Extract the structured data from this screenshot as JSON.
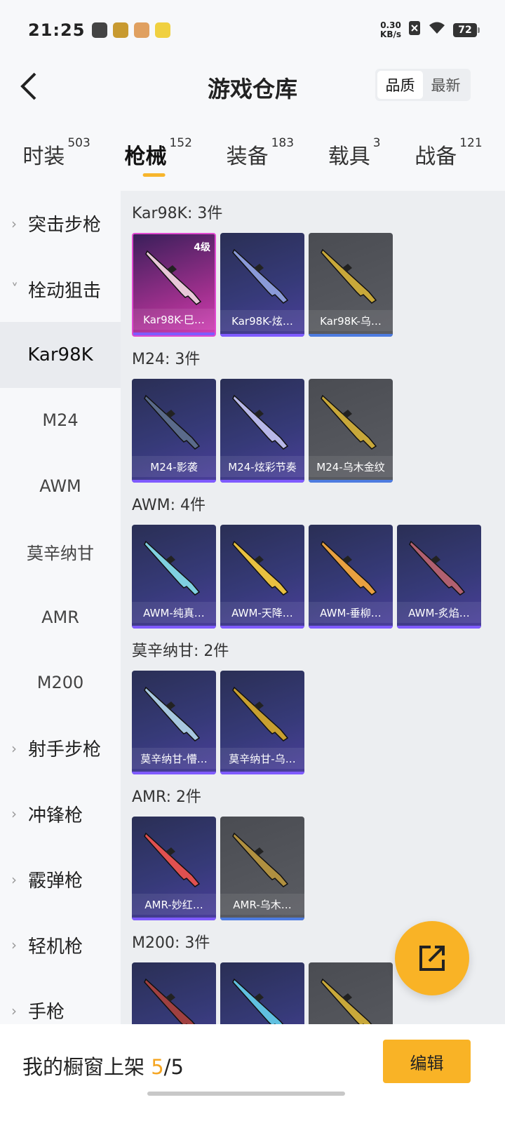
{
  "status_bar": {
    "time": "21:25",
    "speed_value": "0.30",
    "speed_unit": "KB/s",
    "battery": "72"
  },
  "header": {
    "title": "游戏仓库",
    "sort_options": [
      "品质",
      "最新"
    ],
    "active_sort": "品质"
  },
  "tabs": [
    {
      "label": "时装",
      "count": "503"
    },
    {
      "label": "枪械",
      "count": "152"
    },
    {
      "label": "装备",
      "count": "183"
    },
    {
      "label": "载具",
      "count": "3"
    },
    {
      "label": "战备",
      "count": "121"
    }
  ],
  "sidebar": {
    "items": [
      {
        "label": "突击步枪",
        "type": "cat",
        "chev": "›"
      },
      {
        "label": "栓动狙击",
        "type": "cat",
        "chev": "˅"
      },
      {
        "label": "Kar98K",
        "type": "sub",
        "active": true
      },
      {
        "label": "M24",
        "type": "sub"
      },
      {
        "label": "AWM",
        "type": "sub"
      },
      {
        "label": "莫辛纳甘",
        "type": "sub"
      },
      {
        "label": "AMR",
        "type": "sub"
      },
      {
        "label": "M200",
        "type": "sub"
      },
      {
        "label": "射手步枪",
        "type": "cat",
        "chev": "›"
      },
      {
        "label": "冲锋枪",
        "type": "cat",
        "chev": "›"
      },
      {
        "label": "霰弹枪",
        "type": "cat",
        "chev": "›"
      },
      {
        "label": "轻机枪",
        "type": "cat",
        "chev": "›"
      },
      {
        "label": "手枪",
        "type": "cat",
        "chev": "›"
      }
    ]
  },
  "groups": [
    {
      "title": "Kar98K: 3件",
      "items": [
        {
          "label": "Kar98K-巳…",
          "style": "pink",
          "level": "4级",
          "gun_color": "#e8c8d8"
        },
        {
          "label": "Kar98K-炫…",
          "style": "purple",
          "gun_color": "#8a9ad8"
        },
        {
          "label": "Kar98K-乌…",
          "style": "grey",
          "gun_color": "#c8a83a"
        }
      ]
    },
    {
      "title": "M24: 3件",
      "items": [
        {
          "label": "M24-影袭",
          "style": "purple",
          "gun_color": "#5a6a8a"
        },
        {
          "label": "M24-炫彩节奏",
          "style": "purple",
          "gun_color": "#b8b8e8"
        },
        {
          "label": "M24-乌木金纹",
          "style": "grey",
          "gun_color": "#c8a83a"
        }
      ]
    },
    {
      "title": "AWM: 4件",
      "items": [
        {
          "label": "AWM-纯真…",
          "style": "purple",
          "gun_color": "#7fd0e0"
        },
        {
          "label": "AWM-天降…",
          "style": "purple",
          "gun_color": "#e8c040"
        },
        {
          "label": "AWM-垂柳…",
          "style": "purple",
          "gun_color": "#e8a040"
        },
        {
          "label": "AWM-炙焰…",
          "style": "purple",
          "gun_color": "#b06070"
        }
      ]
    },
    {
      "title": "莫辛纳甘: 2件",
      "items": [
        {
          "label": "莫辛纳甘-懵…",
          "style": "purple",
          "gun_color": "#a8c8e0"
        },
        {
          "label": "莫辛纳甘-乌…",
          "style": "purple",
          "gun_color": "#c8a030"
        }
      ]
    },
    {
      "title": "AMR: 2件",
      "items": [
        {
          "label": "AMR-妙红…",
          "style": "purple",
          "gun_color": "#e05050"
        },
        {
          "label": "AMR-乌木…",
          "style": "grey",
          "gun_color": "#b09040"
        }
      ]
    },
    {
      "title": "M200: 3件",
      "items": [
        {
          "label": "",
          "style": "purple",
          "gun_color": "#a04040"
        },
        {
          "label": "",
          "style": "purple",
          "gun_color": "#60c0e0"
        },
        {
          "label": "",
          "style": "grey",
          "gun_color": "#c8a83a"
        }
      ]
    }
  ],
  "bottom_bar": {
    "prefix": "我的橱窗上架 ",
    "current": "5",
    "suffix": "/5",
    "edit_label": "编辑"
  },
  "colors": {
    "accent": "#f9b326",
    "highlight": "#f5a623"
  }
}
